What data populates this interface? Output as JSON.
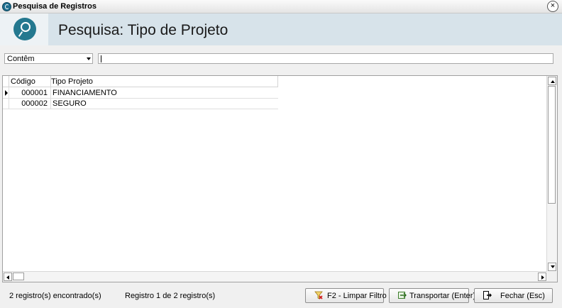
{
  "window": {
    "title": "Pesquisa de Registros",
    "close_symbol": "×"
  },
  "header": {
    "title": "Pesquisa: Tipo de Projeto",
    "icon": "search-icon",
    "accent": "#24788f",
    "band": "#d7e3ea"
  },
  "filter": {
    "mode": "Contêm",
    "search_value": ""
  },
  "grid": {
    "columns": [
      "Código",
      "Tipo Projeto"
    ],
    "rows": [
      {
        "code": "000001",
        "type": "FINANCIAMENTO",
        "current": true
      },
      {
        "code": "000002",
        "type": "SEGURO",
        "current": false
      }
    ]
  },
  "status": {
    "found": "2 registro(s) encontrado(s)",
    "position": "Registro 1 de 2 registro(s)"
  },
  "buttons": {
    "clear_filter": "F2 - Limpar Filtro",
    "transport": "Transportar (Enter)",
    "close": "Fechar (Esc)"
  }
}
